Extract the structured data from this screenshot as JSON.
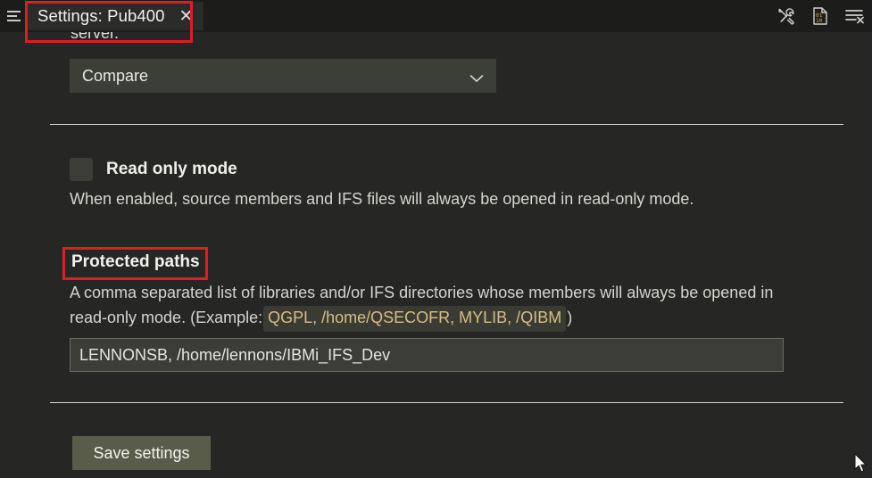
{
  "window": {
    "menu_icon": "list-menu-icon",
    "tab": {
      "title": "Settings: Pub400",
      "close_label": "✕"
    }
  },
  "toolbar": {
    "items": [
      {
        "name": "tools-icon",
        "label": "Tools"
      },
      {
        "name": "binary-file-icon",
        "label": "Binary"
      },
      {
        "name": "clear-list-icon",
        "label": "Clear"
      }
    ]
  },
  "main": {
    "clipped_text": "server.",
    "dropdown": {
      "value": "Compare",
      "chevron": "chevron-down-icon"
    },
    "read_only": {
      "label": "Read only mode",
      "checked": false,
      "description": "When enabled, source members and IFS files will always be opened in read-only mode."
    },
    "protected_paths": {
      "title": "Protected paths",
      "description_line1": "A comma separated list of libraries and/or IFS directories whose members will always be opened in",
      "description_line2_prefix": "read-only mode. (Example: ",
      "description_example": "QGPL, /home/QSECOFR, MYLIB, /QIBM",
      "description_line2_suffix": ")",
      "input_value": "LENNONSB, /home/lennons/IBMi_IFS_Dev",
      "input_placeholder": ""
    },
    "save_button": {
      "label": "Save settings"
    }
  },
  "colors": {
    "background": "#262724",
    "titlebar": "#1c1d1b",
    "tab_background": "#2b2c2a",
    "field_background": "#3b3d36",
    "dropdown_background": "#3c3f35",
    "button_background": "#585c48",
    "code_text": "#d9bc84",
    "annotation": "#e01b24",
    "divider": "#d9d9d3"
  },
  "annotations": [
    {
      "name": "annotation-tab-highlight",
      "target": "Settings: Pub400"
    },
    {
      "name": "annotation-protected-paths-highlight",
      "target": "Protected paths"
    }
  ]
}
